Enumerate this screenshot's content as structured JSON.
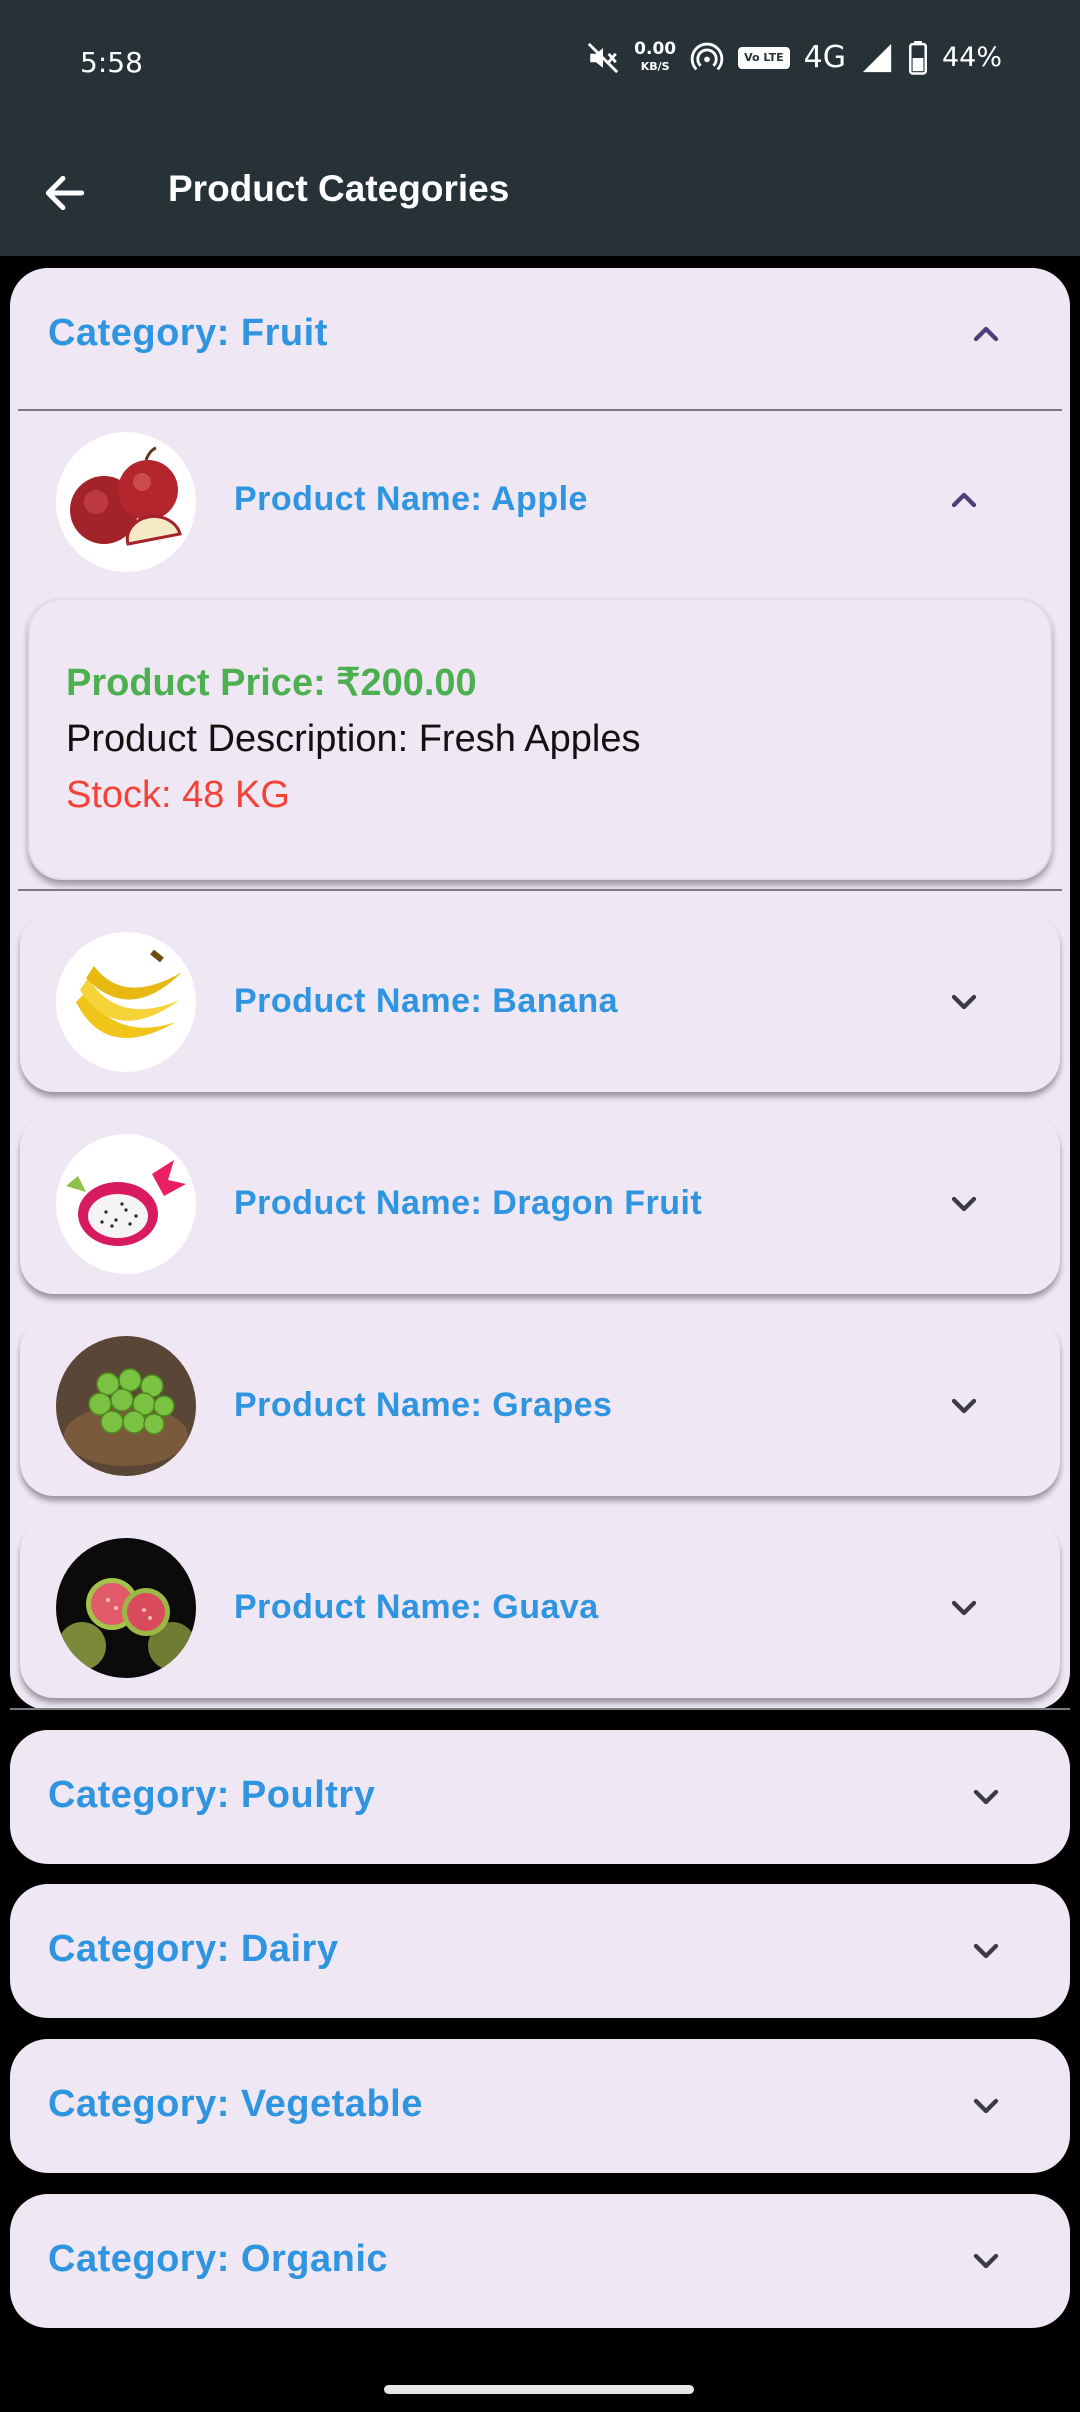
{
  "status_bar": {
    "time": "5:58",
    "net_speed_value": "0.00",
    "net_speed_unit": "KB/S",
    "volte": "Vo LTE",
    "network": "4G",
    "battery": "44%"
  },
  "app_bar": {
    "title": "Product Categories"
  },
  "categories": [
    {
      "label": "Category: Fruit",
      "expanded": true,
      "products": [
        {
          "name": "Product Name: Apple",
          "expanded": true,
          "price": "Product Price: ₹200.00",
          "description": "Product Description: Fresh Apples",
          "stock": "Stock: 48 KG"
        },
        {
          "name": "Product Name: Banana",
          "expanded": false
        },
        {
          "name": "Product Name: Dragon Fruit",
          "expanded": false
        },
        {
          "name": "Product Name: Grapes",
          "expanded": false
        },
        {
          "name": "Product Name: Guava",
          "expanded": false
        }
      ]
    },
    {
      "label": "Category: Poultry",
      "expanded": false
    },
    {
      "label": "Category: Dairy",
      "expanded": false
    },
    {
      "label": "Category: Vegetable",
      "expanded": false
    },
    {
      "label": "Category: Organic",
      "expanded": false
    }
  ],
  "colors": {
    "appbar": "#263238",
    "panel": "#efe7f4",
    "title_blue": "#2f95e0",
    "price_green": "#4caf50",
    "stock_red": "#f44336"
  }
}
